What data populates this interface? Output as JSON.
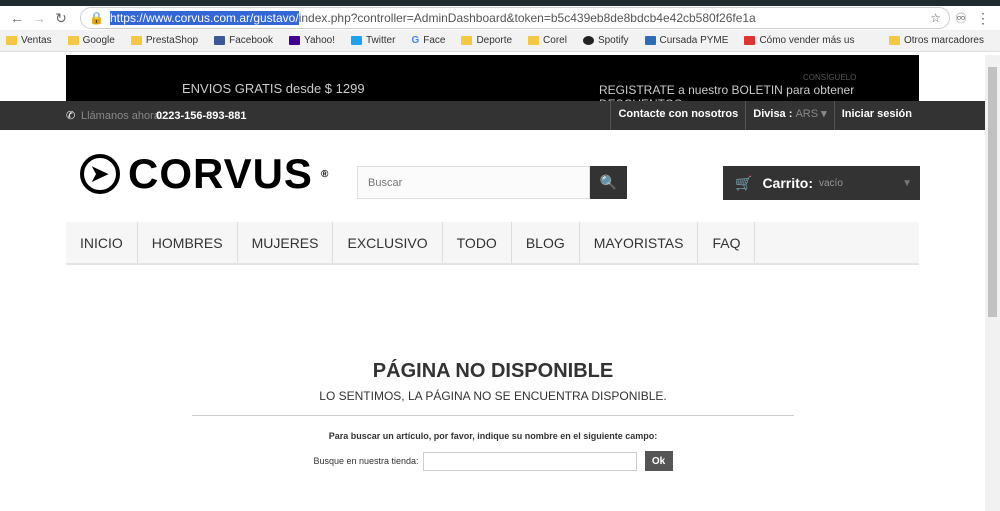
{
  "browser": {
    "url_selected": "https://www.corvus.com.ar/gustavo/",
    "url_rest": "index.php?controller=AdminDashboard&token=b5c439eb8de8bdcb4e42cb580f26fe1a",
    "bookmarks": [
      "Ventas",
      "Google",
      "PrestaShop",
      "Facebook",
      "Yahoo!",
      "Twitter",
      "Face",
      "Deporte",
      "Corel",
      "Spotify",
      "Cursada PYME",
      "Cómo vender más us"
    ],
    "other_bookmarks": "Otros marcadores"
  },
  "banner": {
    "left": "ENVIOS GRATIS desde $ 1299",
    "consiguelo": "CONSÍGUELO",
    "right": "REGISTRATE a nuestro BOLETIN para obtener DESCUENTOS"
  },
  "topbar": {
    "call_label": "Llámanos ahora:",
    "phone": "0223-156-893-881",
    "contact": "Contacte con nosotros",
    "currency_label": "Divisa :",
    "currency": "ARS",
    "login": "Iniciar sesión"
  },
  "header": {
    "logo": "CORVUS",
    "search_placeholder": "Buscar",
    "cart_label": "Carrito:",
    "cart_status": "vacío"
  },
  "menu": [
    "INICIO",
    "HOMBRES",
    "MUJERES",
    "EXCLUSIVO",
    "TODO",
    "BLOG",
    "MAYORISTAS",
    "FAQ"
  ],
  "main": {
    "title": "PÁGINA NO DISPONIBLE",
    "subtitle": "LO SENTIMOS, LA PÁGINA NO SE ENCUENTRA DISPONIBLE.",
    "hint": "Para buscar un artículo, por favor, indique su nombre en el siguiente campo:",
    "search_label": "Busque en nuestra tienda:",
    "ok": "Ok"
  }
}
